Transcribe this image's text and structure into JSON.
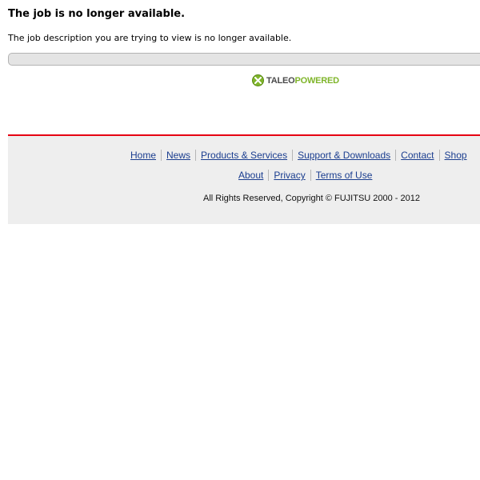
{
  "job": {
    "heading": "The job is no longer available.",
    "message": "The job description you are trying to view is no longer available."
  },
  "logo": {
    "part1": "TALEO",
    "part2": "POWERED",
    "accent_color": "#7fb52a",
    "icon": "taleo-x-icon"
  },
  "footer": {
    "accent_color": "#e60012",
    "links_row1": [
      "Home",
      "News",
      "Products & Services",
      "Support & Downloads",
      "Contact",
      "Shop"
    ],
    "links_row2": [
      "About",
      "Privacy",
      "Terms of Use"
    ],
    "copyright": "All Rights Reserved, Copyright © FUJITSU 2000 - 2012"
  }
}
